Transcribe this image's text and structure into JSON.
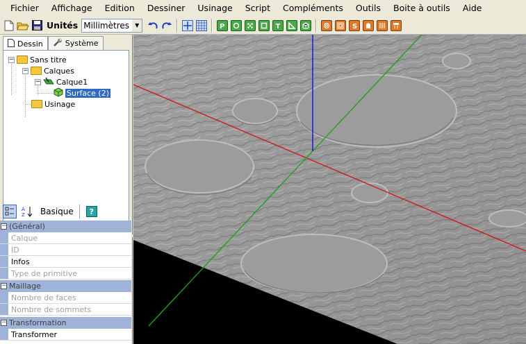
{
  "menu": [
    "Fichier",
    "Affichage",
    "Edition",
    "Dessiner",
    "Usinage",
    "Script",
    "Compléments",
    "Outils",
    "Boite à outils",
    "Aide"
  ],
  "toolbar": {
    "units_label": "Unités",
    "units_value": "Millimètres",
    "icons": [
      "new-file-icon",
      "open-folder-icon",
      "save-icon",
      "undo-icon",
      "redo-icon",
      "axis-icon",
      "grid-icon",
      "draw-p-icon",
      "circle-icon",
      "dice-icon",
      "square-icon",
      "text-t-icon",
      "polyline-icon",
      "surface-icon",
      "toolpath-icon",
      "square-toolpath-icon",
      "letter-s-icon",
      "shape-icon",
      "stripes-icon",
      "calculator-icon"
    ]
  },
  "tabs": [
    "Dessin",
    "Système"
  ],
  "tree": {
    "root": "Sans titre",
    "calques": "Calques",
    "calque1": "Calque1",
    "surface": "Surface (2)",
    "usinage": "Usinage"
  },
  "props": {
    "mode_label": "Basique",
    "categories": {
      "general": "(Général)",
      "maillage": "Maillage",
      "transformation": "Transformation"
    },
    "rows": {
      "calque": "Calque",
      "id": "ID",
      "infos": "Infos",
      "type_primitive": "Type de primitive",
      "nb_faces": "Nombre de faces",
      "nb_sommets": "Nombre de sommets",
      "transformer": "Transformer"
    }
  },
  "viewport": {
    "axis_colors": {
      "x": "#d21a1a",
      "y": "#1fa01f",
      "z": "#2020e0"
    },
    "surface_color": "#a8a8a8"
  }
}
